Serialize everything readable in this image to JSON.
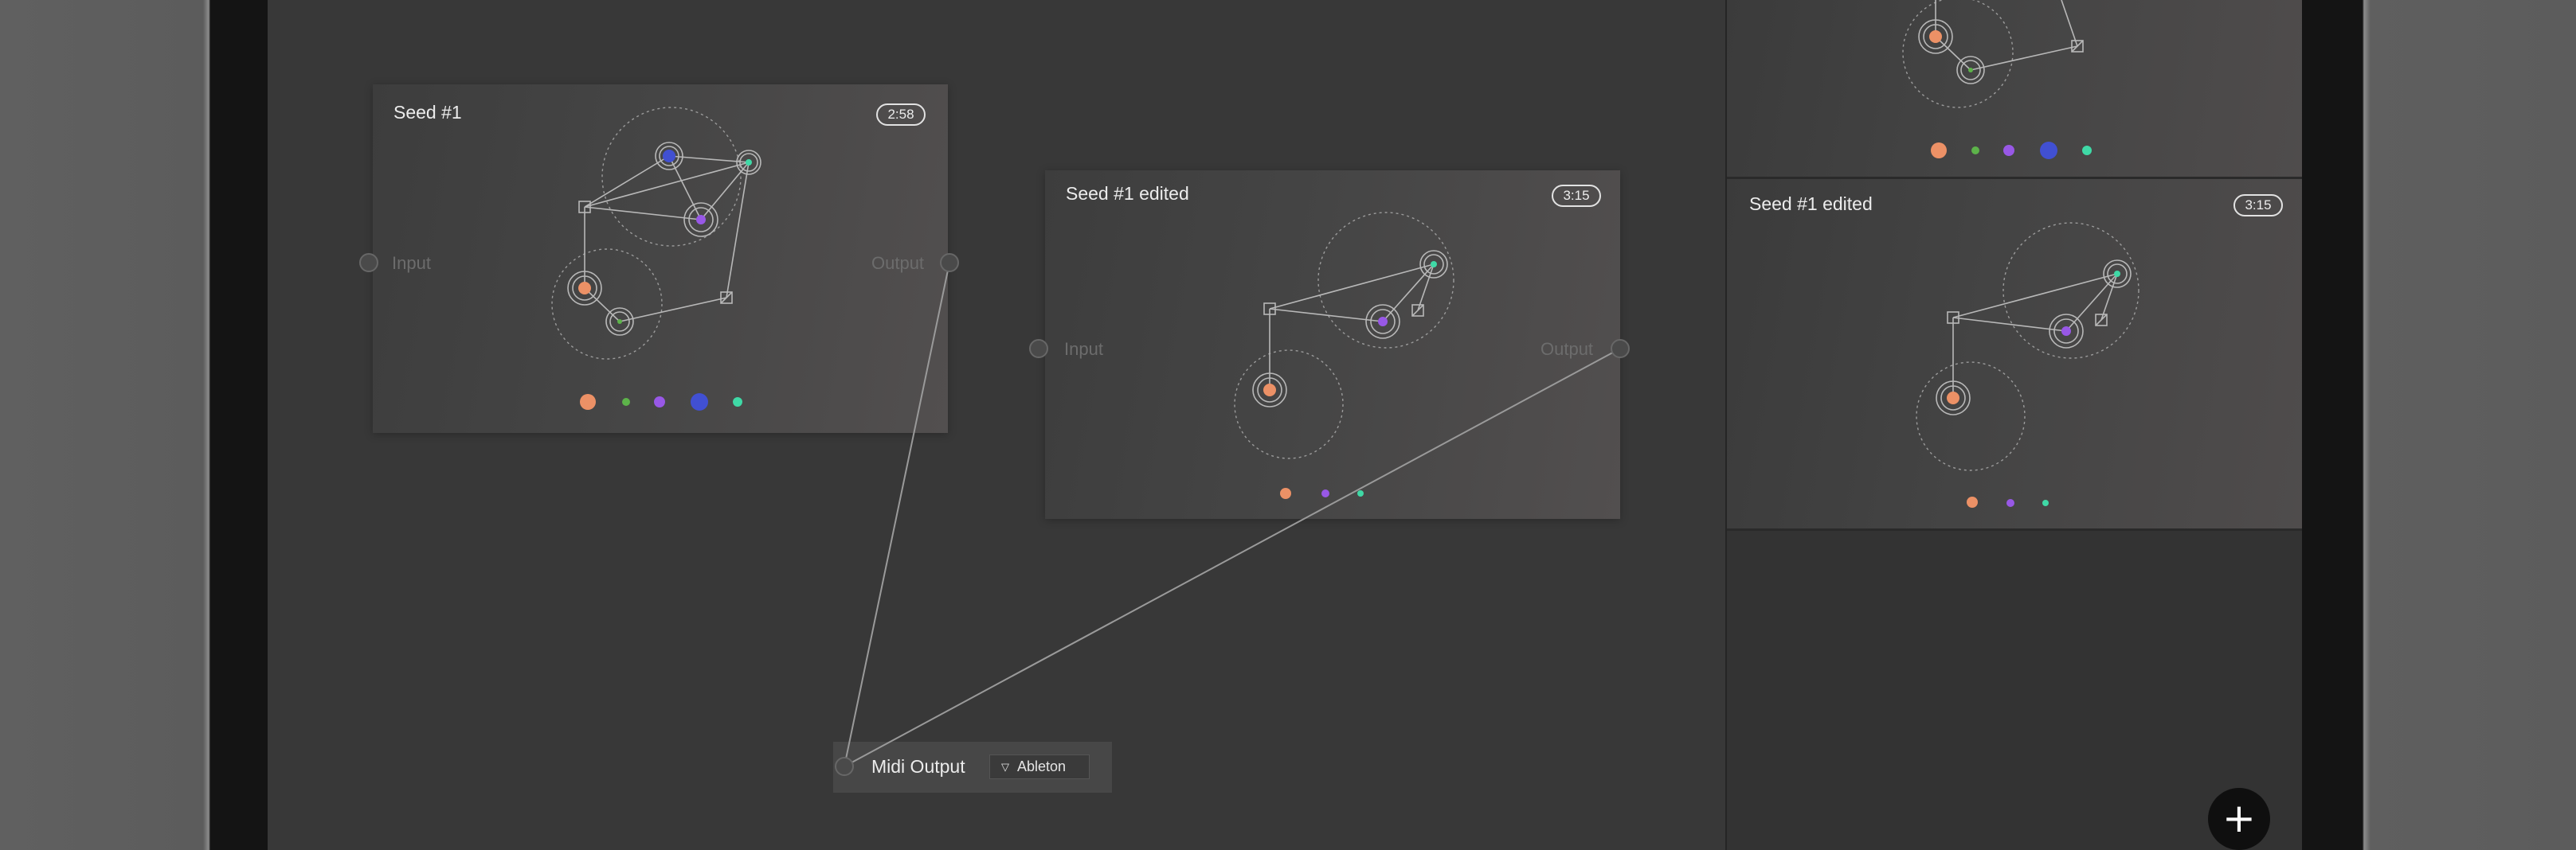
{
  "colors": {
    "orange": "#ec9166",
    "green": "#5db34a",
    "purple": "#9858e6",
    "blue": "#4150d2",
    "teal": "#3fd9a6",
    "canvas": "#383838",
    "sidebar": "#333333"
  },
  "nodes": [
    {
      "title": "Seed #1",
      "duration": "2:58",
      "input_label": "Input",
      "output_label": "Output",
      "dots": [
        "orange",
        "green",
        "purple",
        "blue",
        "teal"
      ]
    },
    {
      "title": "Seed #1 edited",
      "duration": "3:15",
      "input_label": "Input",
      "output_label": "Output",
      "dots": [
        "orange",
        "purple",
        "teal"
      ]
    }
  ],
  "midi_output": {
    "label": "Midi Output",
    "device": "Ableton",
    "dropdown_icon": "triangle-down-icon"
  },
  "sidebar": {
    "cards": [
      {
        "title": "",
        "duration": "",
        "dots": [
          "orange",
          "green",
          "purple",
          "blue",
          "teal"
        ]
      },
      {
        "title": "Seed #1 edited",
        "duration": "3:15",
        "dots": [
          "orange",
          "purple",
          "teal"
        ]
      }
    ]
  },
  "fab": {
    "icon": "plus-icon",
    "label": "+"
  }
}
